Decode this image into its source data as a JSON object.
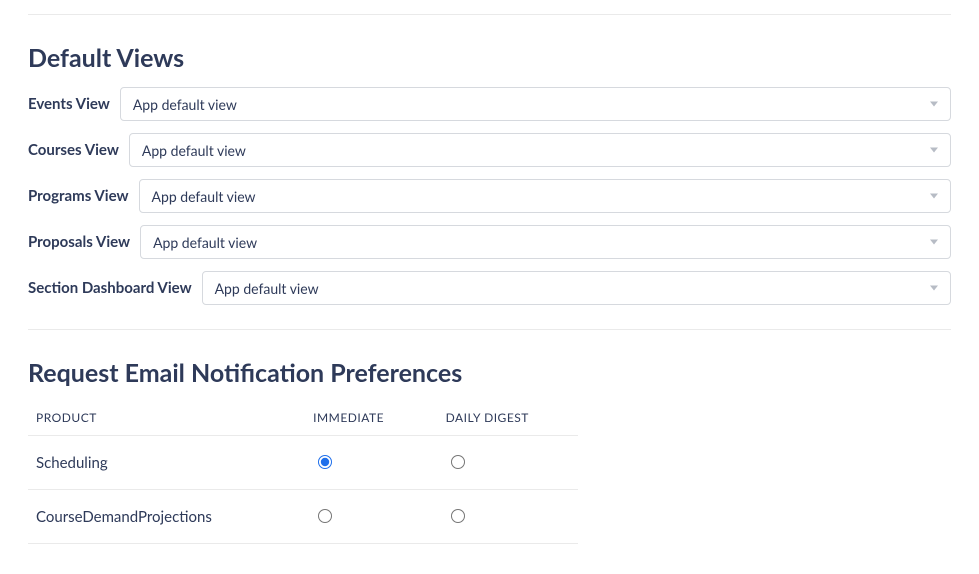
{
  "sections": {
    "default_views": {
      "title": "Default Views",
      "rows": {
        "events": {
          "label": "Events View",
          "value": "App default view"
        },
        "courses": {
          "label": "Courses View",
          "value": "App default view"
        },
        "programs": {
          "label": "Programs View",
          "value": "App default view"
        },
        "proposals": {
          "label": "Proposals View",
          "value": "App default view"
        },
        "dashboard": {
          "label": "Section Dashboard View",
          "value": "App default view"
        }
      }
    },
    "email_prefs": {
      "title": "Request Email Notification Preferences",
      "columns": {
        "product": "PRODUCT",
        "immediate": "IMMEDIATE",
        "daily": "DAILY DIGEST"
      },
      "rows": {
        "scheduling": {
          "product": "Scheduling",
          "immediate": true,
          "daily": false
        },
        "cdp": {
          "product": "CourseDemandProjections",
          "immediate": false,
          "daily": false
        }
      }
    }
  }
}
